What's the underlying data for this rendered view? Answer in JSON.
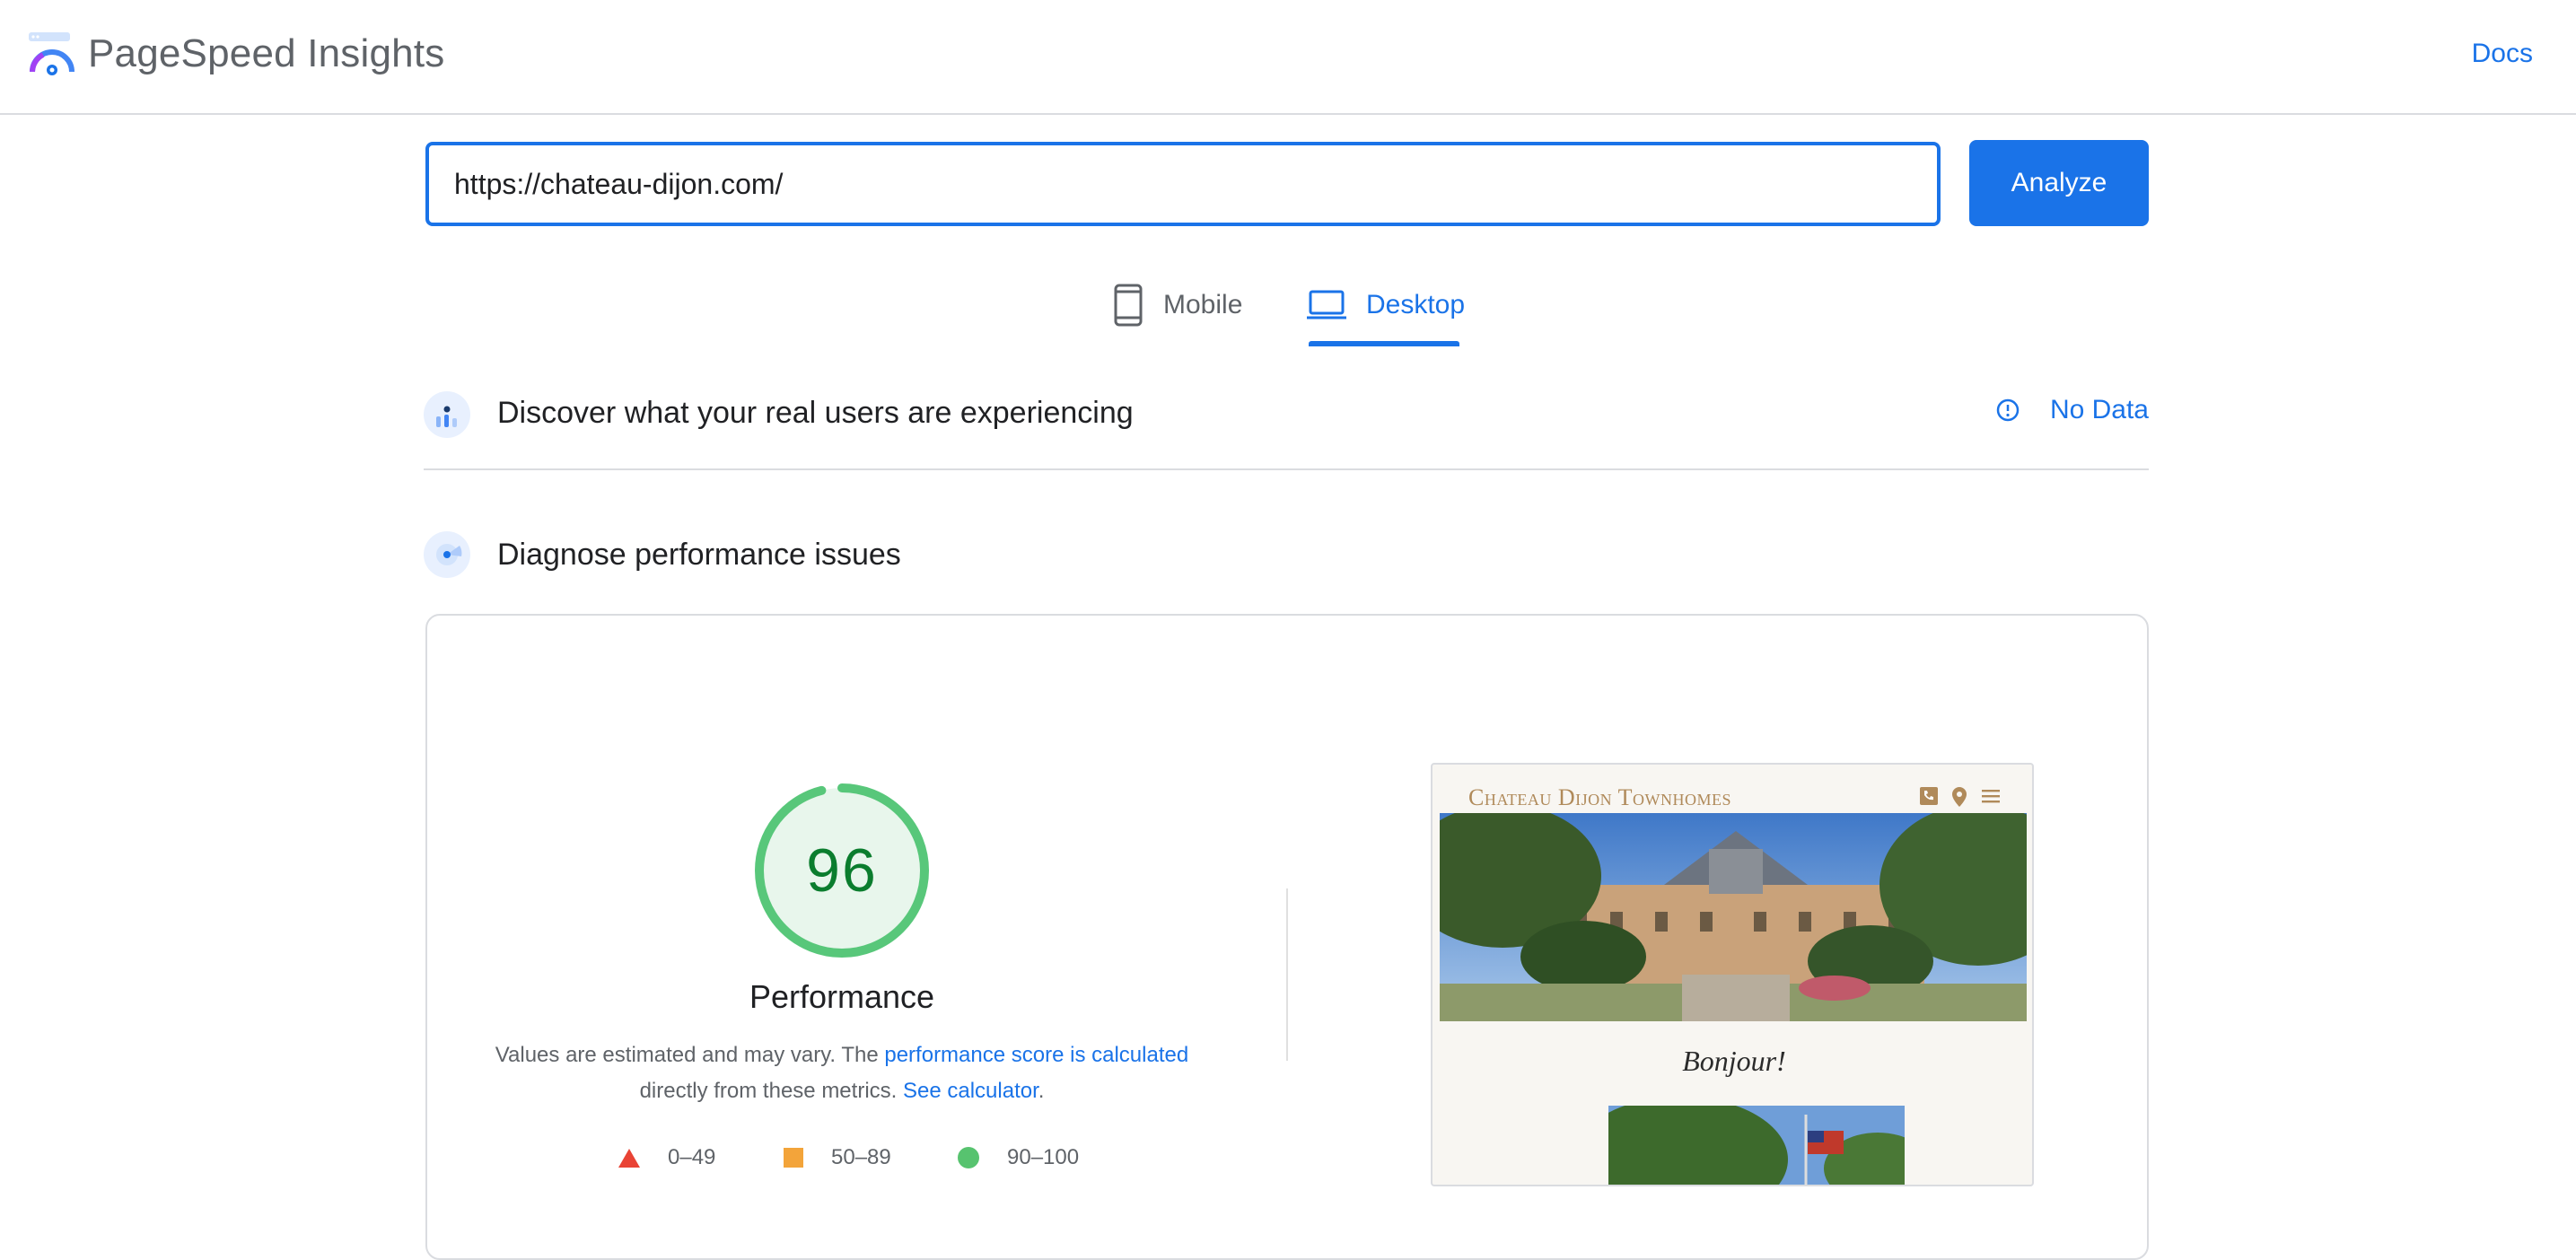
{
  "header": {
    "brand": "PageSpeed Insights",
    "docs_label": "Docs"
  },
  "search": {
    "url_value": "https://chateau-dijon.com/",
    "analyze_label": "Analyze"
  },
  "tabs": [
    {
      "label": "Mobile",
      "icon": "phone-icon",
      "active": false
    },
    {
      "label": "Desktop",
      "icon": "laptop-icon",
      "active": true
    }
  ],
  "field_data": {
    "title": "Discover what your real users are experiencing",
    "status_label": "No Data",
    "icon": "chart-user-icon",
    "status_icon": "info-icon"
  },
  "lab_data": {
    "title": "Diagnose performance issues",
    "icon": "lighthouse-icon"
  },
  "performance": {
    "score": "96",
    "score_fraction": 0.96,
    "label": "Performance",
    "note_prefix": "Values are estimated and may vary. The",
    "note_link1": "performance score is calculated",
    "note_mid": "directly from these metrics.",
    "note_link2": "See calculator",
    "note_suffix": ".",
    "score_color": "#0b7d2e",
    "ring_color": "#58c77a",
    "fill_color": "#e8f6ec"
  },
  "legend": [
    {
      "range": "0–49",
      "shape": "triangle",
      "color": "#e94335"
    },
    {
      "range": "50–89",
      "shape": "square",
      "color": "#f3a43a"
    },
    {
      "range": "90–100",
      "shape": "circle",
      "color": "#57c36f"
    }
  ],
  "screenshot": {
    "site_title": "Chateau Dijon Townhomes",
    "greeting": "Bonjour!",
    "accent": "#b08a5a"
  },
  "colors": {
    "primary": "#1a73e8",
    "text": "#202124",
    "muted": "#5f6368",
    "border": "#dadce0"
  }
}
